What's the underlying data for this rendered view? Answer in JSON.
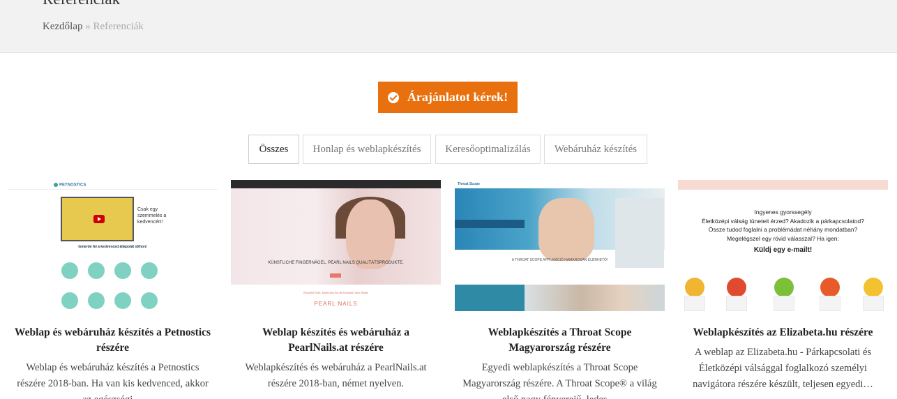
{
  "page": {
    "title": "Referenciák",
    "breadcrumb": {
      "home": "Kezdőlap",
      "separator": "»",
      "current": "Referenciák"
    }
  },
  "cta": {
    "label": "Árajánlatot kérek!",
    "icon": "check-circle-icon",
    "color": "#e8700e"
  },
  "filters": [
    {
      "label": "Összes",
      "active": true
    },
    {
      "label": "Honlap és weblapkészítés",
      "active": false
    },
    {
      "label": "Keresőoptimalizálás",
      "active": false
    },
    {
      "label": "Webáruház készítés",
      "active": false
    }
  ],
  "portfolio": [
    {
      "title": "Weblap és webáruház készítés a Petnostics részére",
      "desc": "Weblap és webáruház készítés a Petnostics részére 2018-ban. Ha van kis kedvenced, akkor az egészségi…",
      "thumb": {
        "logo": "PETNOSTICS",
        "headline": "Csak egy szemmelés a kedvencért!",
        "section": "Ismerde fel a kedvenced állapotát otthon!"
      }
    },
    {
      "title": "Weblap készítés és webáruház a PearlNails.at részére",
      "desc": "Weblapkészítés és webáruház a PearlNails.at részére 2018-ban, német nyelven.",
      "thumb": {
        "slogan": "KÜNSTLICHE FINGERNÄGEL, PEARL NAILS QUALITÄTSPRODUKTE.",
        "tagline": "Beautiful Nails. Entdecken Sie die Schönheit Ihrer Hände",
        "brand": "PEARL NAILS"
      }
    },
    {
      "title": "Weblapkészítés a Throat Scope Magyarország részére",
      "desc": "Egyedi weblapkészítés a Throat Scope Magyarország részére. A Throat Scope® a világ első nagy fényerejű, ledes…",
      "thumb": {
        "logo": "Throat Scope",
        "mid": "A THROAT SCOPE APPLIKÁCIÓ HAMAROSAN ELÉRHETŐ!"
      }
    },
    {
      "title": "Weblapkészítés az Elizabeta.hu részére",
      "desc": "A weblap az Elizabeta.hu - Párkapcsolati és Életközépi válsággal foglalkozó személyi navigátora részére készült, teljesen egyedi…",
      "thumb": {
        "lines": [
          "Ingyenes gyorssegély",
          "Életközépi válság tüneteit érzed? Akadozik a párkapcsolatod?",
          "Össze tudod foglalni a problémádat néhány mondatban?",
          "Megelégszel egy rövid válasszal? Ha igen:"
        ],
        "big": "Küldj egy e-mailt!"
      }
    }
  ]
}
